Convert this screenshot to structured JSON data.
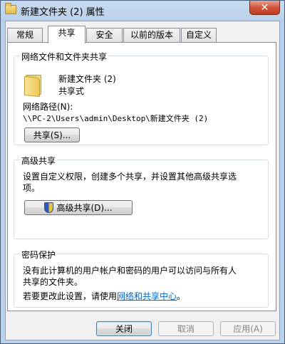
{
  "window": {
    "title": "新建文件夹 (2) 属性",
    "close_glyph": "✕"
  },
  "tabs": [
    {
      "label": "常规"
    },
    {
      "label": "共享"
    },
    {
      "label": "安全"
    },
    {
      "label": "以前的版本"
    },
    {
      "label": "自定义"
    }
  ],
  "network_sharing": {
    "title": "网络文件和文件夹共享",
    "folder_name": "新建文件夹 (2)",
    "folder_status": "共享式",
    "path_label": "网络路径(N):",
    "path_value": "\\\\PC-2\\Users\\admin\\Desktop\\新建文件夹 (2)",
    "share_button": "共享(S)..."
  },
  "advanced_sharing": {
    "title": "高级共享",
    "description": "设置自定义权限，创建多个共享，并设置其他高级共享选项。",
    "description_line1": "设置自定义权限，创建多个共享，并设置其他高级共享选",
    "description_line2": "项。",
    "button": "高级共享(D)..."
  },
  "password_protection": {
    "title": "密码保护",
    "description_line1": "没有此计算机的用户帐户和密码的用户可以访问与所有人",
    "description_line2": "共享的文件夹。",
    "change_prefix": "若要更改此设置，请使用",
    "link_text": "网络和共享中心",
    "change_suffix": "。"
  },
  "footer": {
    "close_button": "关闭",
    "cancel_button": "取消",
    "apply_button": "应用(A)"
  }
}
